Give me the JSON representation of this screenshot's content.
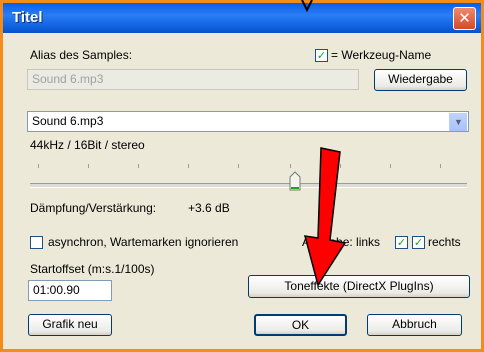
{
  "window": {
    "title": "Titel",
    "close_label": "✕"
  },
  "alias": {
    "label": "Alias des Samples:",
    "value": "Sound 6.mp3",
    "tool_name_checkbox_label": "= Werkzeug-Name",
    "tool_name_checked": true
  },
  "playback_button": "Wiedergabe",
  "sound_select": {
    "value": "Sound 6.mp3",
    "format": "44kHz / 16Bit / stereo"
  },
  "attenuation": {
    "label": "Dämpfung/Verstärkung:",
    "value": "+3.6 dB",
    "level_fraction": 0.6
  },
  "async": {
    "label": "asynchron, Wartemarken ignorieren",
    "checked": false
  },
  "output": {
    "label": "Ausgabe: links",
    "right_label": "rechts",
    "left_checked": true,
    "right_checked": true
  },
  "start_offset": {
    "label": "Startoffset (m:s.1/100s)",
    "value": "01:00.90"
  },
  "buttons": {
    "effects": "Toneffekte (DirectX PlugIns)",
    "graphic_new": "Grafik neu",
    "ok": "OK",
    "cancel": "Abbruch"
  },
  "annotation": {
    "arrow_color": "#ff0000"
  },
  "colors": {
    "titlebar": "#0a5ee8",
    "dialog_bg": "#ece9d8",
    "outer_border": "#f28c1a"
  }
}
